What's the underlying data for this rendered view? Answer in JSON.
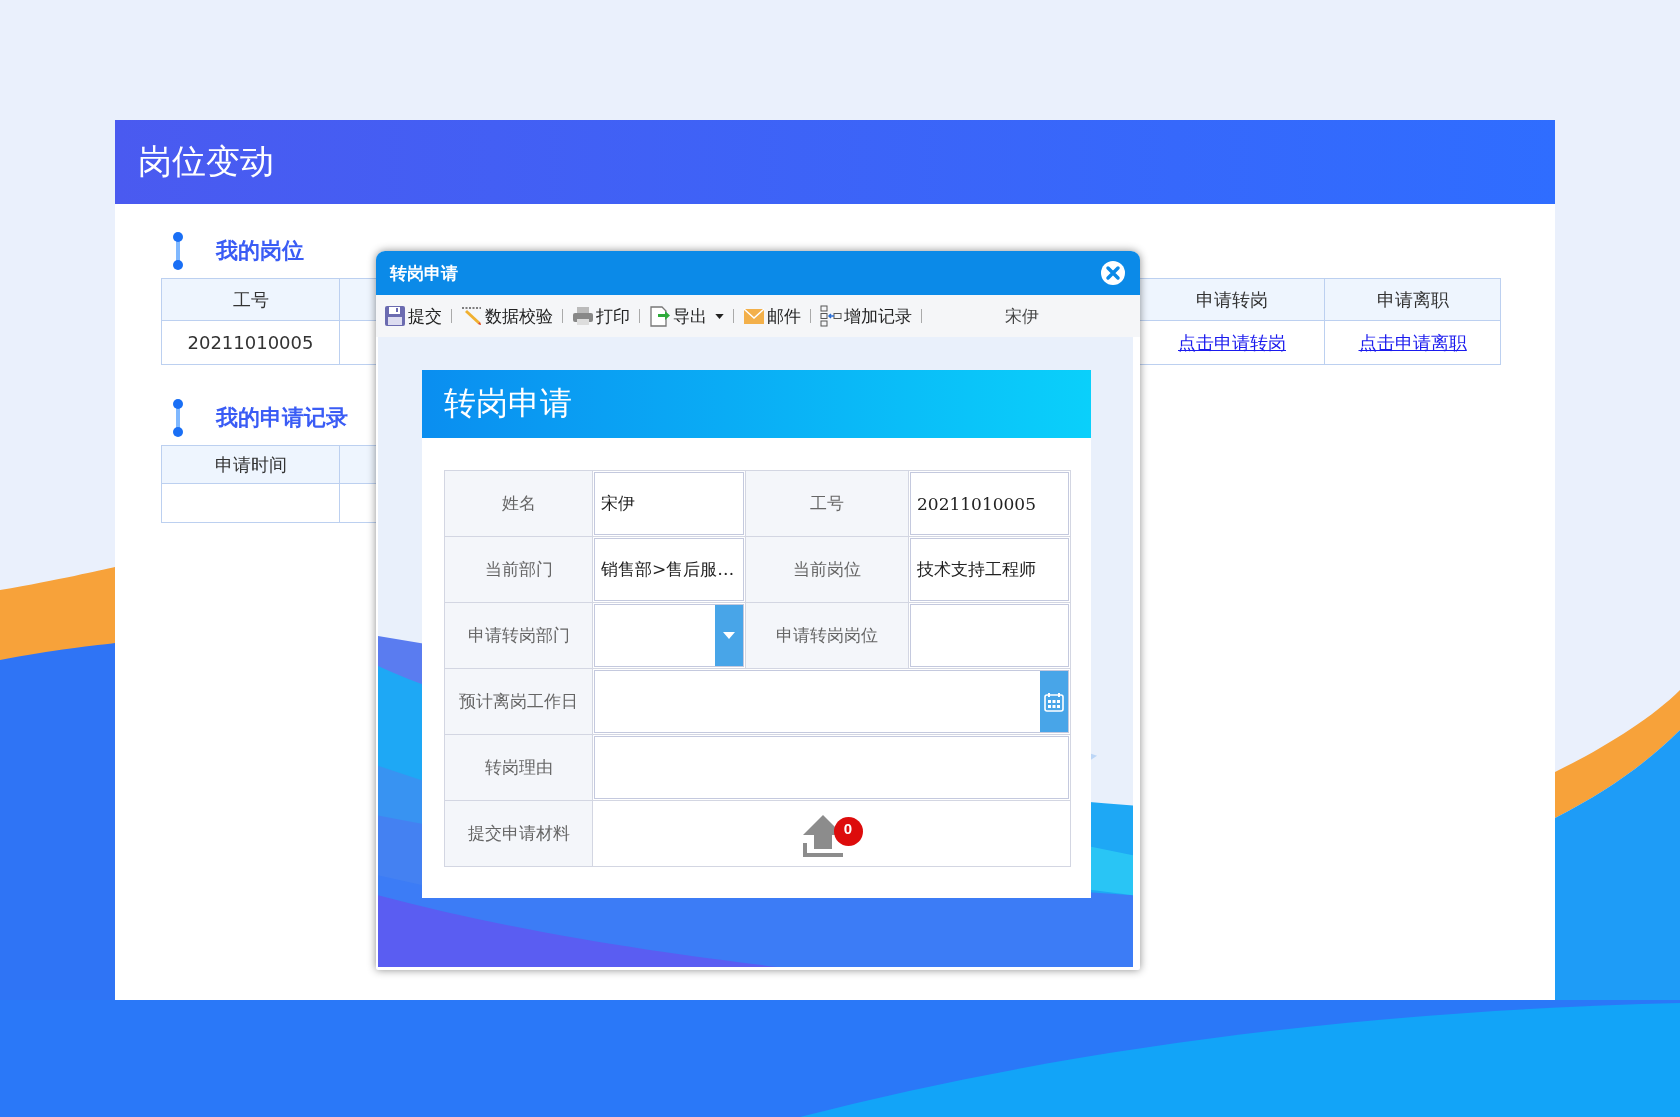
{
  "page": {
    "title": "岗位变动"
  },
  "position_section": {
    "title": "我的岗位",
    "left_columns": [
      "工号"
    ],
    "right_columns": [
      "申请转岗",
      "申请离职"
    ],
    "left_cells": [
      "20211010005"
    ],
    "right_links": [
      "点击申请转岗",
      "点击申请离职"
    ]
  },
  "records_section": {
    "title": "我的申请记录",
    "columns": [
      "申请时间"
    ]
  },
  "dialog": {
    "title": "转岗申请",
    "toolbar": [
      {
        "label": "提交",
        "dropdown": false
      },
      {
        "label": "数据校验",
        "dropdown": false
      },
      {
        "label": "打印",
        "dropdown": false
      },
      {
        "label": "导出",
        "dropdown": true
      },
      {
        "label": "邮件",
        "dropdown": false
      },
      {
        "label": "增加记录",
        "dropdown": false
      }
    ],
    "user": "宋伊",
    "form": {
      "title": "转岗申请",
      "rows": [
        [
          {
            "label": "姓名",
            "kind": "text",
            "value": "宋伊"
          },
          {
            "label": "工号",
            "kind": "text",
            "value": "20211010005"
          }
        ],
        [
          {
            "label": "当前部门",
            "kind": "text",
            "value": "销售部>售后服…"
          },
          {
            "label": "当前岗位",
            "kind": "text",
            "value": "技术支持工程师"
          }
        ],
        [
          {
            "label": "申请转岗部门",
            "kind": "select"
          },
          {
            "label": "申请转岗岗位",
            "kind": "text"
          }
        ],
        [
          {
            "label": "预计离岗工作日",
            "kind": "date"
          }
        ],
        [
          {
            "label": "转岗理由",
            "kind": "textarea"
          }
        ],
        [
          {
            "label": "提交申请材料",
            "kind": "upload",
            "count": "0"
          }
        ]
      ]
    }
  }
}
